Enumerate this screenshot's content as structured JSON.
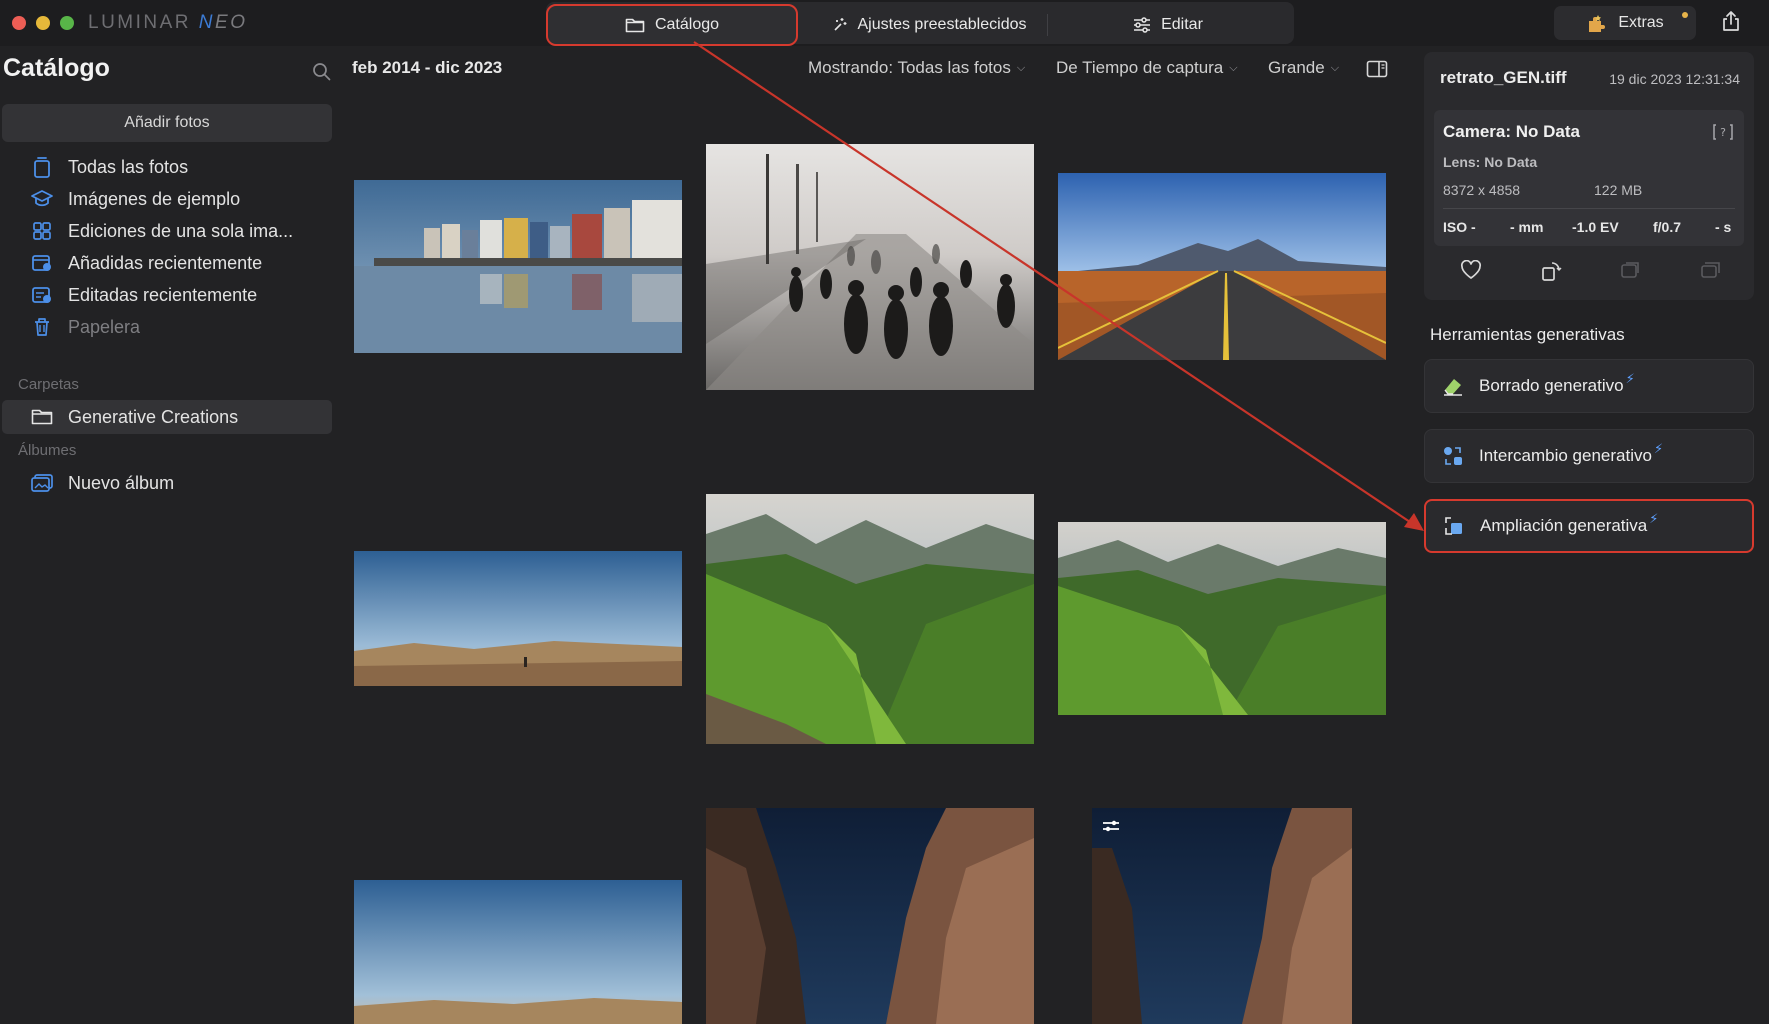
{
  "app": {
    "logo_main": "LUMINAR ",
    "logo_n": "N",
    "logo_e": "E",
    "logo_o": "O"
  },
  "colors": {
    "accent_red": "#d63a2e",
    "bolt_blue": "#5ea0ff",
    "bg": "#222224"
  },
  "topbar": {
    "tabs": [
      {
        "label": "Catálogo",
        "icon": "folder-icon",
        "active": true
      },
      {
        "label": "Ajustes preestablecidos",
        "icon": "sparkle-icon",
        "active": false
      },
      {
        "label": "Editar",
        "icon": "sliders-icon",
        "active": false
      }
    ],
    "extras_label": "Extras"
  },
  "sidebar": {
    "title": "Catálogo",
    "add_photos": "Añadir fotos",
    "items": [
      {
        "label": "Todas las fotos",
        "icon": "photos-stack-icon"
      },
      {
        "label": "Imágenes de ejemplo",
        "icon": "graduation-cap-icon"
      },
      {
        "label": "Ediciones de una sola ima...",
        "icon": "grid-icon"
      },
      {
        "label": "Añadidas recientemente",
        "icon": "recent-added-icon"
      },
      {
        "label": "Editadas recientemente",
        "icon": "recent-edited-icon"
      },
      {
        "label": "Papelera",
        "icon": "trash-icon"
      }
    ],
    "folders_header": "Carpetas",
    "folders": [
      {
        "label": "Generative Creations",
        "icon": "folder-icon"
      }
    ],
    "albums_header": "Álbumes",
    "albums": [
      {
        "label": "Nuevo álbum",
        "icon": "album-add-icon"
      }
    ]
  },
  "toolbar": {
    "date_range": "feb 2014 - dic 2023",
    "showing": "Mostrando: Todas las fotos",
    "sort": "De Tiempo de captura",
    "size": "Grande"
  },
  "photos": [
    "harbor-houses-reflection",
    "foggy-pier-silhouettes",
    "desert-road-mountains",
    "desert-wide-sky",
    "green-valley-mountains",
    "green-valley-mountains-2",
    "desert-sky-crop",
    "canyon-night",
    "canyon-night-edited"
  ],
  "info": {
    "file": "retrato_GEN.tiff",
    "date": "19 dic 2023 12:31:34",
    "camera": "Camera: No Data",
    "lens": "Lens: No Data",
    "dimensions": "8372 x 4858",
    "filesize": "122 MB",
    "iso": "ISO -",
    "focal": "- mm",
    "ev": "-1.0 EV",
    "aperture": "f/0.7",
    "shutter": "- s"
  },
  "generative": {
    "title": "Herramientas generativas",
    "tools": [
      {
        "label": "Borrado generativo",
        "icon": "eraser-icon"
      },
      {
        "label": "Intercambio generativo",
        "icon": "swap-icon"
      },
      {
        "label": "Ampliación generativa",
        "icon": "expand-icon",
        "highlighted": true
      }
    ],
    "bolt": "⚡"
  }
}
